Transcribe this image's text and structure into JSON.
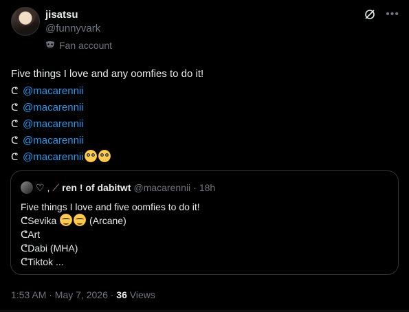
{
  "author": {
    "name": "jisatsu",
    "handle": "@funnyvark",
    "badge_label": "Fan account",
    "badge_icon": "mask-icon"
  },
  "tweet": {
    "intro": "Five things I love and any oomfies to do it!",
    "bullet_icon": "hook-bullet-icon",
    "mentions": [
      "@macarennii",
      "@macarennii",
      "@macarennii",
      "@macarennii",
      "@macarennii"
    ],
    "last_line_emojis": [
      "flushed-face-emoji",
      "flushed-face-emoji"
    ]
  },
  "quote": {
    "name_prefix": "♡ ,",
    "name": "ren ! of dabitwt",
    "handle": "@macarennii",
    "separator": "·",
    "time": "18h",
    "lines": [
      "Five things I love and five oomfies to do it!",
      "Sevika",
      "(Arcane)",
      "Art",
      "Dabi (MHA)",
      "Tiktok ..."
    ],
    "bullet": "ᕦ"
  },
  "meta": {
    "timestamp": "1:53 AM · May 7, 2026 ·",
    "views_count": "36",
    "views_label": "Views"
  },
  "icons": {
    "grok": "grok-icon",
    "more": "more-icon"
  },
  "colors": {
    "background": "#000000",
    "text": "#e7e9ea",
    "muted": "#71767b",
    "link": "#1d9bf0",
    "border": "#2f3336"
  }
}
